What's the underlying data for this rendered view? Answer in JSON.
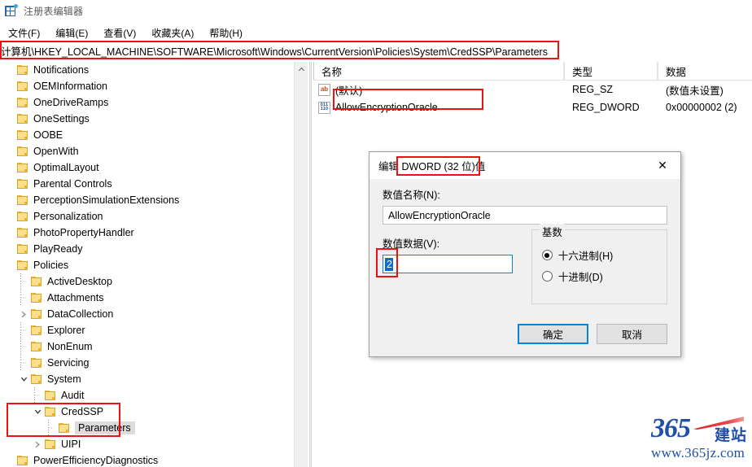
{
  "window": {
    "title": "注册表编辑器",
    "icon": "registry-editor-icon"
  },
  "menubar": {
    "items": [
      {
        "label": "文件(F)",
        "mnemonic": "F"
      },
      {
        "label": "编辑(E)",
        "mnemonic": "E"
      },
      {
        "label": "查看(V)",
        "mnemonic": "V"
      },
      {
        "label": "收藏夹(A)",
        "mnemonic": "A"
      },
      {
        "label": "帮助(H)",
        "mnemonic": "H"
      }
    ]
  },
  "address": {
    "path": "计算机\\HKEY_LOCAL_MACHINE\\SOFTWARE\\Microsoft\\Windows\\CurrentVersion\\Policies\\System\\CredSSP\\Parameters",
    "highlight_color": "#ee1111"
  },
  "tree": {
    "items": [
      {
        "label": "Notifications",
        "indent": 1,
        "twisty": "none",
        "selected": false
      },
      {
        "label": "OEMInformation",
        "indent": 1,
        "twisty": "none",
        "selected": false
      },
      {
        "label": "OneDriveRamps",
        "indent": 1,
        "twisty": "none",
        "selected": false
      },
      {
        "label": "OneSettings",
        "indent": 1,
        "twisty": "none",
        "selected": false
      },
      {
        "label": "OOBE",
        "indent": 1,
        "twisty": "none",
        "selected": false
      },
      {
        "label": "OpenWith",
        "indent": 1,
        "twisty": "none",
        "selected": false
      },
      {
        "label": "OptimalLayout",
        "indent": 1,
        "twisty": "none",
        "selected": false
      },
      {
        "label": "Parental Controls",
        "indent": 1,
        "twisty": "none",
        "selected": false
      },
      {
        "label": "PerceptionSimulationExtensions",
        "indent": 1,
        "twisty": "none",
        "selected": false
      },
      {
        "label": "Personalization",
        "indent": 1,
        "twisty": "none",
        "selected": false
      },
      {
        "label": "PhotoPropertyHandler",
        "indent": 1,
        "twisty": "none",
        "selected": false
      },
      {
        "label": "PlayReady",
        "indent": 1,
        "twisty": "none",
        "selected": false
      },
      {
        "label": "Policies",
        "indent": 1,
        "twisty": "none",
        "selected": false
      },
      {
        "label": "ActiveDesktop",
        "indent": 2,
        "twisty": "none",
        "selected": false
      },
      {
        "label": "Attachments",
        "indent": 2,
        "twisty": "none",
        "selected": false
      },
      {
        "label": "DataCollection",
        "indent": 2,
        "twisty": "closed",
        "selected": false
      },
      {
        "label": "Explorer",
        "indent": 2,
        "twisty": "none",
        "selected": false
      },
      {
        "label": "NonEnum",
        "indent": 2,
        "twisty": "none",
        "selected": false
      },
      {
        "label": "Servicing",
        "indent": 2,
        "twisty": "none",
        "selected": false
      },
      {
        "label": "System",
        "indent": 2,
        "twisty": "open",
        "selected": false
      },
      {
        "label": "Audit",
        "indent": 3,
        "twisty": "none",
        "selected": false
      },
      {
        "label": "CredSSP",
        "indent": 3,
        "twisty": "open",
        "selected": false
      },
      {
        "label": "Parameters",
        "indent": 4,
        "twisty": "none",
        "selected": true
      },
      {
        "label": "UIPI",
        "indent": 3,
        "twisty": "closed",
        "selected": false
      },
      {
        "label": "PowerEfficiencyDiagnostics",
        "indent": 1,
        "twisty": "none",
        "selected": false
      }
    ],
    "highlight_group": {
      "labels": [
        "CredSSP",
        "Parameters"
      ],
      "color": "#ee1111"
    },
    "scrollbar": {
      "up_arrow": "chevron-up-icon"
    }
  },
  "list": {
    "columns": [
      "名称",
      "类型",
      "数据"
    ],
    "rows": [
      {
        "icon": "string-value-icon",
        "name": "(默认)",
        "type": "REG_SZ",
        "data": "(数值未设置)",
        "highlighted": false
      },
      {
        "icon": "dword-value-icon",
        "name": "AllowEncryptionOracle",
        "type": "REG_DWORD",
        "data": "0x00000002 (2)",
        "highlighted": true
      }
    ],
    "string_icon_glyph": "ab",
    "dword_icon_glyph_top": "011",
    "dword_icon_glyph_bottom": "110",
    "highlight_color": "#ee1111"
  },
  "dialog": {
    "title": "编辑 DWORD (32 位)值",
    "title_prefix": "编辑 ",
    "title_highlighted": "DWORD (32 位",
    "title_suffix": ")值",
    "close_icon": "close-icon",
    "name_label": "数值名称(N):",
    "name_value": "AllowEncryptionOracle",
    "data_label": "数值数据(V):",
    "data_value": "2",
    "data_value_selected": true,
    "base_group_title": "基数",
    "radios": [
      {
        "label": "十六进制(H)",
        "checked": true
      },
      {
        "label": "十进制(D)",
        "checked": false
      }
    ],
    "ok_label": "确定",
    "cancel_label": "取消",
    "focus_color": "#0a84d8",
    "highlight_color": "#ee1111"
  },
  "watermark": {
    "number": "365",
    "cn": "建站",
    "url": "www.365jz.com",
    "brand_color": "#1f4fa8",
    "accent_color": "#d81f24"
  }
}
